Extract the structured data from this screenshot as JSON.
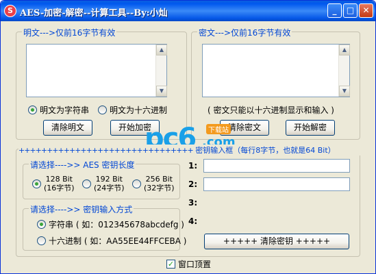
{
  "window": {
    "title": "AES-加密-解密--计算工具--By:小灿",
    "app_icon": "S"
  },
  "plain": {
    "legend": "明文--->仅前16字节有效",
    "radio_string": "明文为字符串",
    "radio_hex": "明文为十六进制",
    "clear_button": "清除明文",
    "encrypt_button": "开始加密"
  },
  "cipher": {
    "legend": "密文--->仅前16字节有效",
    "note": "( 密文只能以十六进制显示和输入 )",
    "clear_button": "清除密文",
    "decrypt_button": "开始解密"
  },
  "key": {
    "header_plus": "+++++++++++++++++++++++++++++++",
    "header_text": "密钥输入框（每行8字节，也就是64 Bit）",
    "length_legend": "请选择---->> AES 密钥长度",
    "bits": [
      {
        "bit": "128 Bit",
        "bytes": "(16字节)"
      },
      {
        "bit": "192 Bit",
        "bytes": "(24字节)"
      },
      {
        "bit": "256 Bit",
        "bytes": "(32字节)"
      }
    ],
    "mode_legend": "请选择---->> 密钥输入方式",
    "mode_string": "字符串 ( 如：012345678abcdefg )",
    "mode_hex": "十六进制 ( 如：AA55EE44FFCEBA )",
    "rows": [
      "1:",
      "2:",
      "3:",
      "4:"
    ],
    "clear_button": "+++++   清除密钥   +++++"
  },
  "topmost": {
    "label": "窗口顶置"
  },
  "watermark": {
    "pc6": "pc6",
    "com": ".com",
    "dl": "下载站"
  }
}
